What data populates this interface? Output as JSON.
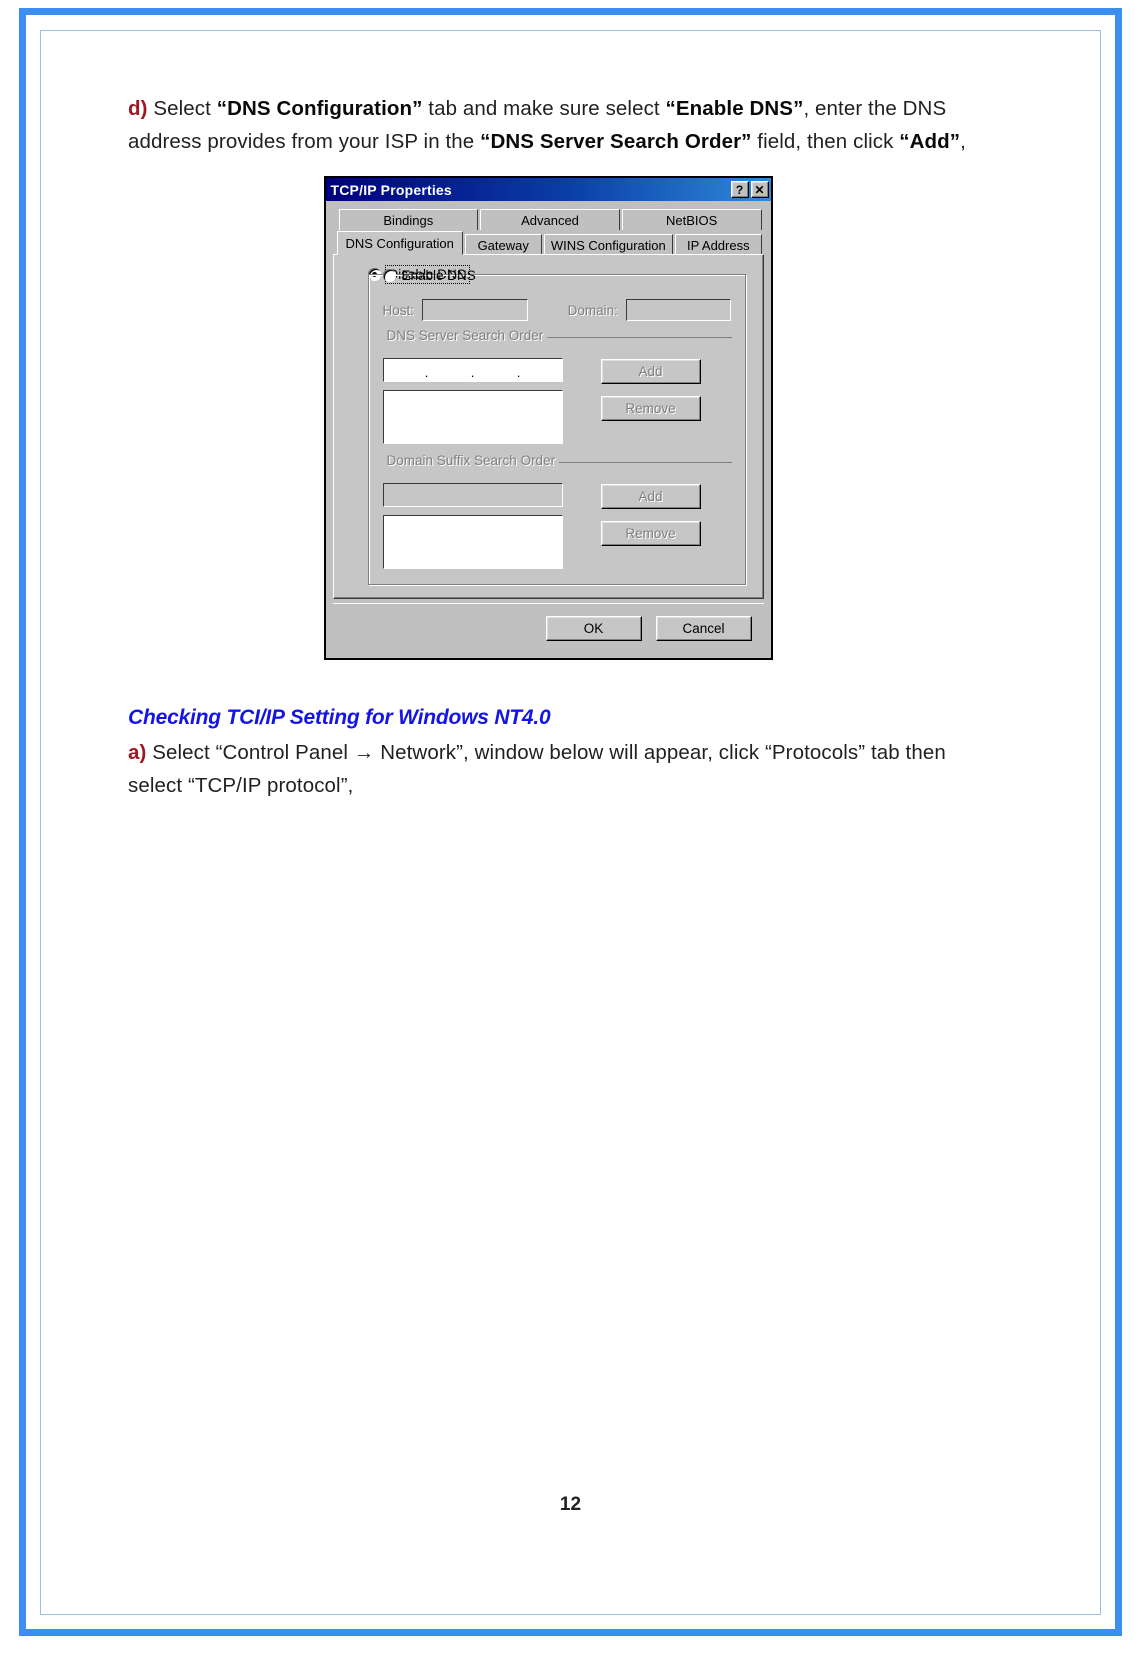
{
  "document": {
    "page_number": "12"
  },
  "steps": {
    "step_d": {
      "marker": "d)",
      "part1": " Select ",
      "bold1": "“DNS Configuration”",
      "part2": " tab and make sure select ",
      "bold2": "“Enable DNS”",
      "part3": ", enter the DNS address provides from your ISP in the ",
      "bold3": "“DNS Server Search Order”",
      "part4": " field, then click ",
      "bold4": "“Add”",
      "part5": ","
    },
    "section_heading": "Checking TCI/IP Setting for Windows NT4.0",
    "step_a": {
      "marker": "a)",
      "text": " Select “Control Panel → Network”, window below will appear, click “Protocols” tab then select “TCP/IP protocol”,"
    }
  },
  "dialog": {
    "title": "TCP/IP Properties",
    "titlebar_buttons": [
      {
        "name": "help-button",
        "glyph": "?"
      },
      {
        "name": "close-button",
        "glyph": "✕"
      }
    ],
    "tabs_row1": [
      {
        "label": "Bindings",
        "active": false
      },
      {
        "label": "Advanced",
        "active": false
      },
      {
        "label": "NetBIOS",
        "active": false
      }
    ],
    "tabs_row2": [
      {
        "label": "DNS Configuration",
        "active": true
      },
      {
        "label": "Gateway",
        "active": false
      },
      {
        "label": "WINS Configuration",
        "active": false
      },
      {
        "label": "IP Address",
        "active": false
      }
    ],
    "radios": {
      "disable_dns": {
        "label": "Disable DNS",
        "selected": true
      },
      "enable_dns": {
        "label": "Enable DNS",
        "selected": false
      }
    },
    "fields": {
      "host_label": "Host:",
      "host_value": "",
      "domain_label": "Domain:",
      "domain_value": ""
    },
    "dns_search": {
      "legend": "DNS Server Search Order",
      "ip_octets": [
        "",
        "",
        "",
        ""
      ],
      "ip_separator": ".",
      "list_items": [],
      "add_label": "Add",
      "remove_label": "Remove"
    },
    "domain_suffix_search": {
      "legend": "Domain Suffix Search Order",
      "input_value": "",
      "list_items": [],
      "add_label": "Add",
      "remove_label": "Remove"
    },
    "footer": {
      "ok_label": "OK",
      "cancel_label": "Cancel"
    }
  },
  "colors": {
    "frame_blue": "#3c8ef0",
    "heading_blue": "#1414e6",
    "marker_red": "#a01722",
    "dialog_face": "#c0c0c0",
    "titlebar_start": "#00007e",
    "titlebar_end": "#2f8ad8"
  }
}
